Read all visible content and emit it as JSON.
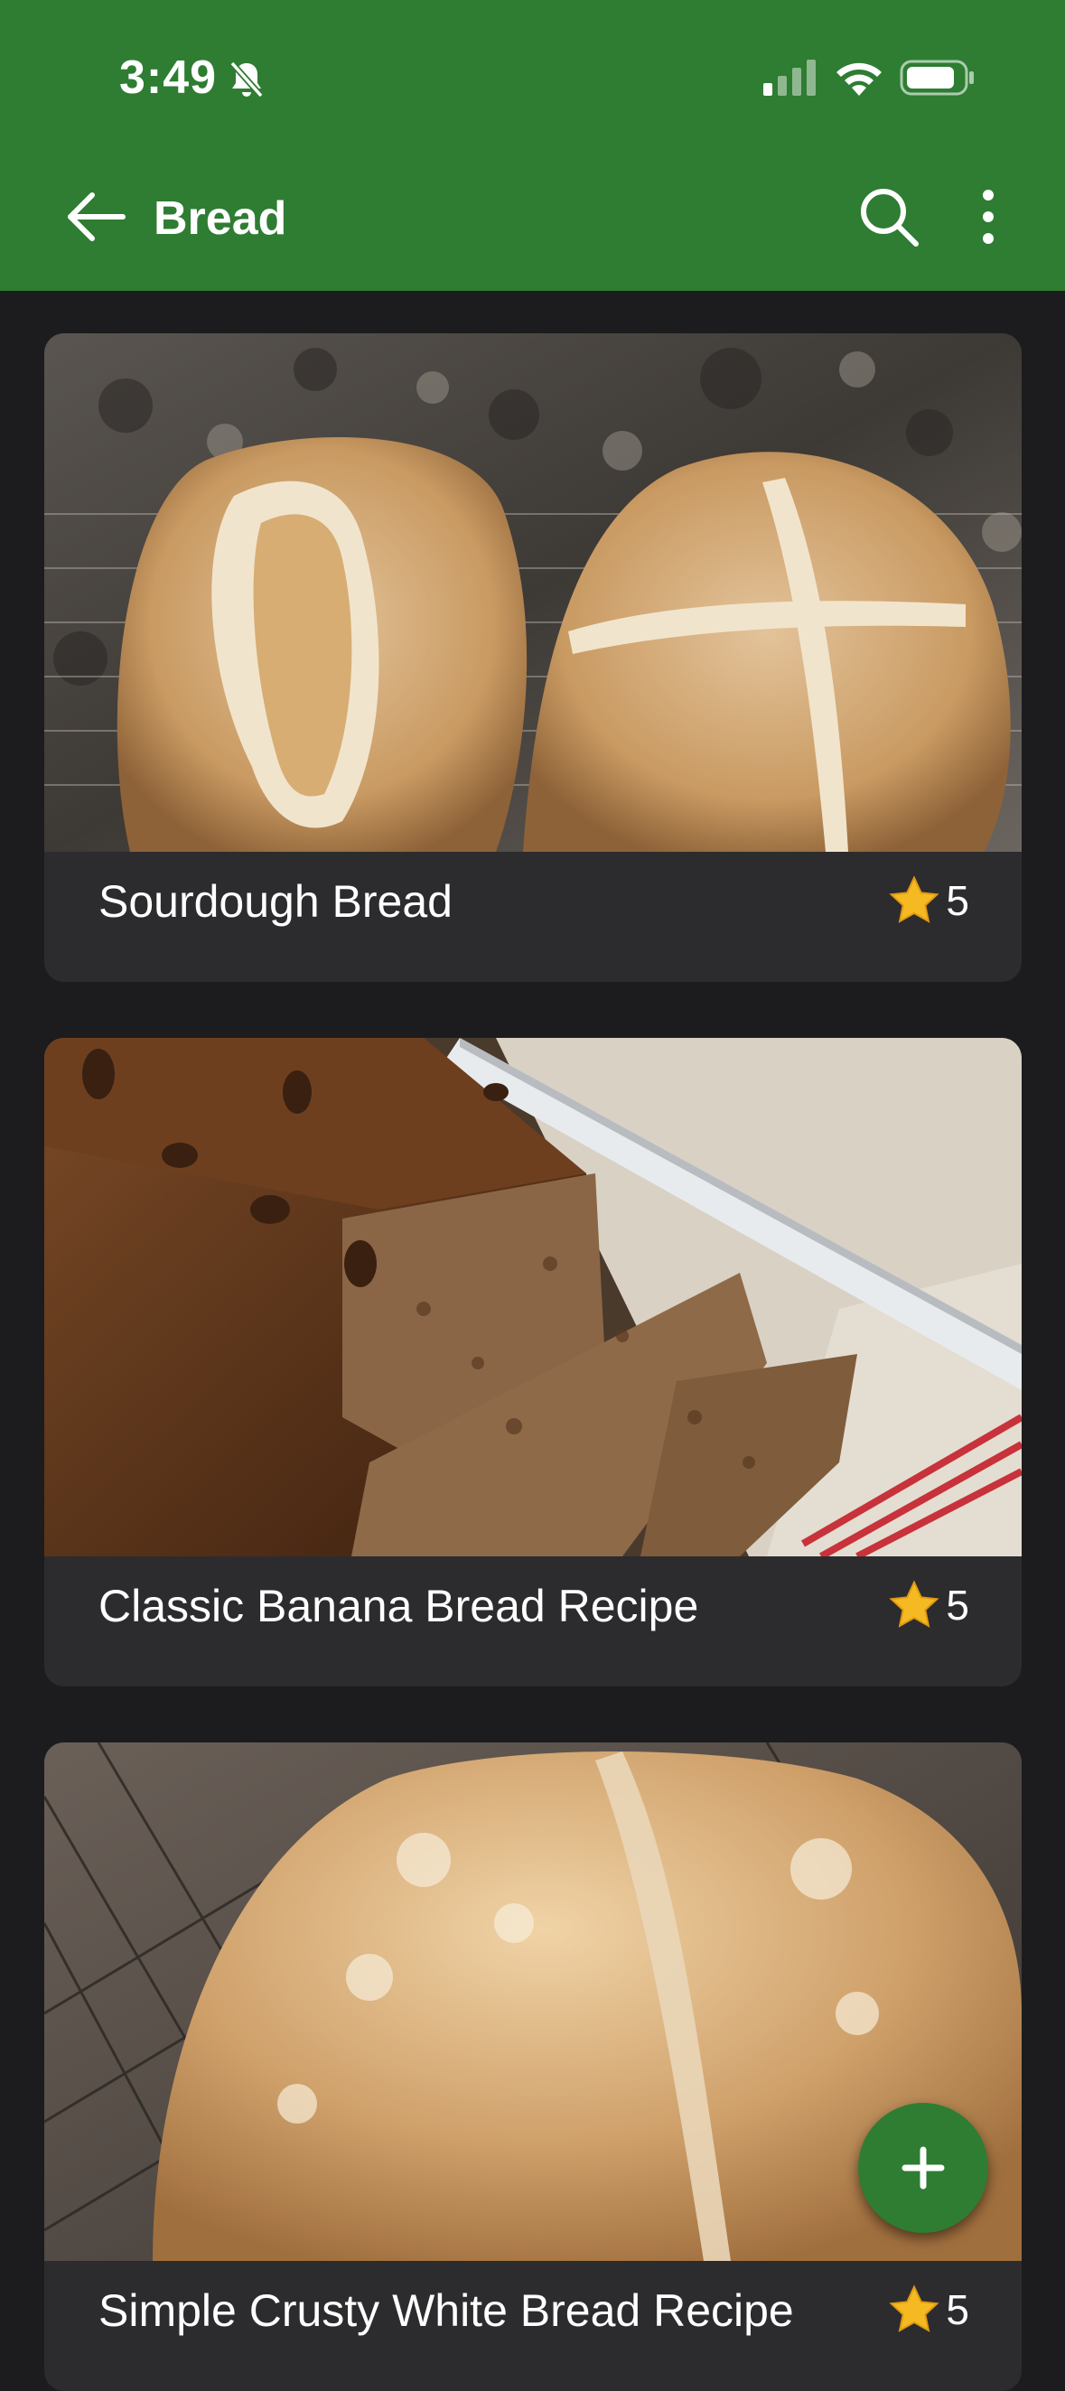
{
  "status_bar": {
    "time": "3:49"
  },
  "app_bar": {
    "title": "Bread"
  },
  "recipes": [
    {
      "name": "Sourdough Bread",
      "rating": "5"
    },
    {
      "name": "Classic Banana Bread Recipe",
      "rating": "5"
    },
    {
      "name": "Simple Crusty White Bread Recipe",
      "rating": "5"
    }
  ],
  "colors": {
    "primary": "#2e7d32",
    "background": "#1c1c1e",
    "card": "#2c2c2e",
    "star": "#f5b921"
  }
}
